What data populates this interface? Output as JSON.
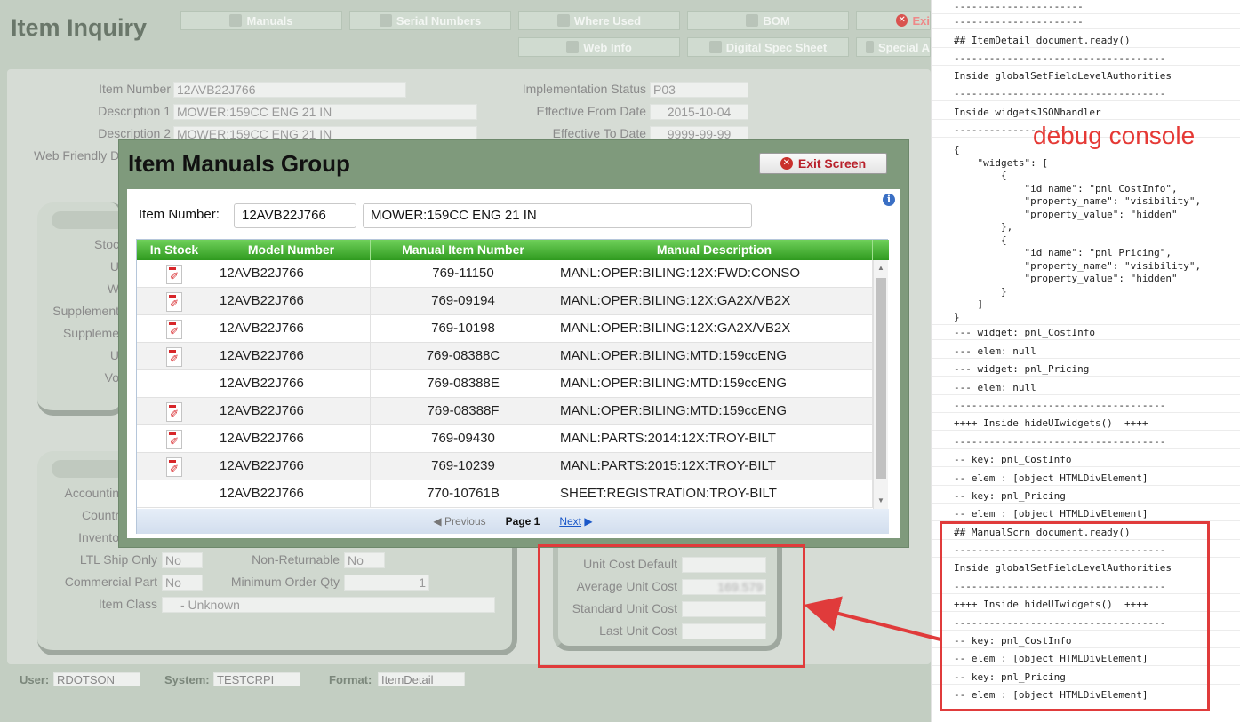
{
  "app": {
    "title": "Item Inquiry",
    "nav": {
      "manuals": "Manuals",
      "serial_numbers": "Serial Numbers",
      "where_used": "Where Used",
      "bom": "BOM",
      "exit": "Exi",
      "web_info": "Web Info",
      "digital_spec_sheet": "Digital Spec Sheet",
      "special": "Special A"
    },
    "fields": {
      "item_number_label": "Item Number",
      "item_number": "12AVB22J766",
      "description1_label": "Description 1",
      "description1": "MOWER:159CC ENG 21 IN",
      "description2_label": "Description 2",
      "description2": "MOWER:159CC ENG 21 IN",
      "web_friendly_label": "Web Friendly De",
      "impl_status_label": "Implementation Status",
      "impl_status": "P03",
      "eff_from_label": "Effective From Date",
      "eff_from": "2015-10-04",
      "eff_to_label": "Effective To Date",
      "eff_to": "9999-99-99"
    },
    "left_labels": [
      "Stoc",
      "U",
      "W",
      "Supplement",
      "Suppleme",
      "U",
      "Vo"
    ],
    "lower_labels": [
      "Accountin",
      "Countr",
      "Invento"
    ],
    "lower_fields": {
      "ltl_label": "LTL Ship Only",
      "ltl": "No",
      "nonret_label": "Non-Returnable",
      "nonret": "No",
      "commercial_label": "Commercial Part",
      "commercial": "No",
      "minqty_label": "Minimum Order Qty",
      "minqty": "1",
      "class_label": "Item Class",
      "class": "- Unknown"
    },
    "cost": {
      "unit_default_label": "Unit Cost Default",
      "average_label": "Average Unit Cost",
      "average_value": "169.579",
      "standard_label": "Standard Unit Cost",
      "last_label": "Last Unit Cost"
    },
    "footer": {
      "user_label": "User:",
      "user": "RDOTSON",
      "system_label": "System:",
      "system": "TESTCRPI",
      "format_label": "Format:",
      "format": "ItemDetail"
    }
  },
  "modal": {
    "title": "Item Manuals Group",
    "exit_label": "Exit Screen",
    "item_number_label": "Item Number:",
    "item_number": "12AVB22J766",
    "item_description": "MOWER:159CC ENG 21 IN",
    "columns": [
      "In Stock",
      "Model Number",
      "Manual Item Number",
      "Manual Description"
    ],
    "rows": [
      {
        "pdf": true,
        "model": "12AVB22J766",
        "manual": "769-11150",
        "desc": "MANL:OPER:BILING:12X:FWD:CONSO"
      },
      {
        "pdf": true,
        "model": "12AVB22J766",
        "manual": "769-09194",
        "desc": "MANL:OPER:BILING:12X:GA2X/VB2X"
      },
      {
        "pdf": true,
        "model": "12AVB22J766",
        "manual": "769-10198",
        "desc": "MANL:OPER:BILING:12X:GA2X/VB2X"
      },
      {
        "pdf": true,
        "model": "12AVB22J766",
        "manual": "769-08388C",
        "desc": "MANL:OPER:BILING:MTD:159ccENG"
      },
      {
        "pdf": false,
        "model": "12AVB22J766",
        "manual": "769-08388E",
        "desc": "MANL:OPER:BILING:MTD:159ccENG"
      },
      {
        "pdf": true,
        "model": "12AVB22J766",
        "manual": "769-08388F",
        "desc": "MANL:OPER:BILING:MTD:159ccENG"
      },
      {
        "pdf": true,
        "model": "12AVB22J766",
        "manual": "769-09430",
        "desc": "MANL:PARTS:2014:12X:TROY-BILT"
      },
      {
        "pdf": true,
        "model": "12AVB22J766",
        "manual": "769-10239",
        "desc": "MANL:PARTS:2015:12X:TROY-BILT"
      },
      {
        "pdf": false,
        "model": "12AVB22J766",
        "manual": "770-10761B",
        "desc": "SHEET:REGISTRATION:TROY-BILT"
      }
    ],
    "pager": {
      "previous": "Previous",
      "page": "Page 1",
      "next": "Next"
    }
  },
  "console": {
    "label": "debug console",
    "lines": [
      "----------------------",
      "----------------------",
      "## ItemDetail document.ready()",
      "------------------------------------",
      "Inside globalSetFieldLevelAuthorities",
      "------------------------------------",
      "Inside widgetsJSONhandler",
      "---------------------",
      "{\n    \"widgets\": [\n        {\n            \"id_name\": \"pnl_CostInfo\",\n            \"property_name\": \"visibility\",\n            \"property_value\": \"hidden\"\n        },\n        {\n            \"id_name\": \"pnl_Pricing\",\n            \"property_name\": \"visibility\",\n            \"property_value\": \"hidden\"\n        }\n    ]\n}",
      "--- widget: pnl_CostInfo",
      "--- elem: null",
      "--- widget: pnl_Pricing",
      "--- elem: null",
      "------------------------------------",
      "++++ Inside hideUIwidgets()  ++++",
      "------------------------------------",
      "-- key: pnl_CostInfo",
      "-- elem : [object HTMLDivElement]",
      "-- key: pnl_Pricing",
      "-- elem : [object HTMLDivElement]",
      "## ManualScrn document.ready()",
      "------------------------------------",
      "Inside globalSetFieldLevelAuthorities",
      "------------------------------------",
      "++++ Inside hideUIwidgets()  ++++",
      "------------------------------------",
      "-- key: pnl_CostInfo",
      "-- elem : [object HTMLDivElement]",
      "-- key: pnl_Pricing",
      "-- elem : [object HTMLDivElement]"
    ]
  },
  "colors": {
    "annotation": "#e03b3b",
    "header_green": "#2f9a1f",
    "link": "#1a57c8"
  }
}
